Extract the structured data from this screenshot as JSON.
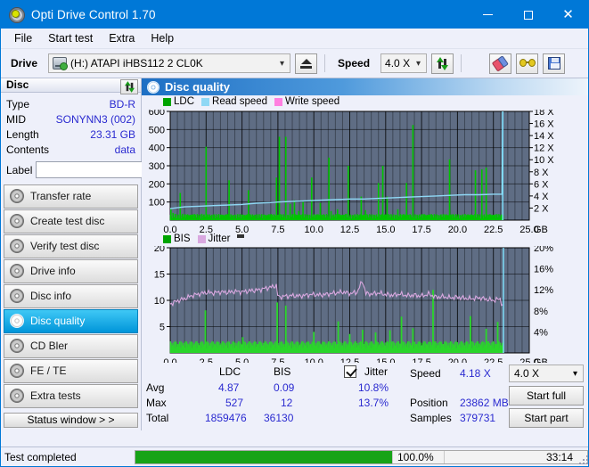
{
  "window": {
    "title": "Opti Drive Control 1.70",
    "icon": "disc-icon",
    "minimize": "–",
    "maximize": "□",
    "close": "✕"
  },
  "menu": {
    "items": [
      "File",
      "Start test",
      "Extra",
      "Help"
    ]
  },
  "toolbar": {
    "drive_label": "Drive",
    "drive_value": "(H:)  ATAPI iHBS112  2 CL0K",
    "drive_icon": "drive-icon",
    "eject_icon": "eject-icon",
    "speed_label": "Speed",
    "speed_value": "4.0 X",
    "refresh_icon": "refresh-icon",
    "eraser_icon": "eraser-icon",
    "glasses_icon": "glasses-icon",
    "save_icon": "save-icon",
    "chevron": "⌄"
  },
  "disc_panel": {
    "title": "Disc",
    "refresh_icon": "refresh-icon",
    "rows": [
      {
        "key": "Type",
        "value": "BD-R"
      },
      {
        "key": "MID",
        "value": "SONYNN3 (002)"
      },
      {
        "key": "Length",
        "value": "23.31 GB"
      },
      {
        "key": "Contents",
        "value": "data"
      }
    ],
    "label_key": "Label",
    "label_value": "",
    "label_placeholder": "",
    "disc_icon": "disc-icon"
  },
  "tests": {
    "items": [
      {
        "label": "Transfer rate",
        "active": false
      },
      {
        "label": "Create test disc",
        "active": false
      },
      {
        "label": "Verify test disc",
        "active": false
      },
      {
        "label": "Drive info",
        "active": false
      },
      {
        "label": "Disc info",
        "active": false
      },
      {
        "label": "Disc quality",
        "active": true
      },
      {
        "label": "CD Bler",
        "active": false
      },
      {
        "label": "FE / TE",
        "active": false
      },
      {
        "label": "Extra tests",
        "active": false
      }
    ],
    "status_window": "Status window > >"
  },
  "content": {
    "header_title": "Disc quality",
    "header_icon": "disc-quality-icon"
  },
  "chart_data": [
    {
      "type": "line",
      "name": "ldc-read-speed-chart",
      "title": "",
      "xlabel": "GB",
      "ylabel": "",
      "legend": [
        {
          "label": "LDC",
          "color": "#00a400"
        },
        {
          "label": "Read speed",
          "color": "#8fd8f5"
        },
        {
          "label": "Write speed",
          "color": "#ff7fe0"
        }
      ],
      "xlim": [
        0,
        25.0
      ],
      "xticks": [
        "0.0",
        "2.5",
        "5.0",
        "7.5",
        "10.0",
        "12.5",
        "15.0",
        "17.5",
        "20.0",
        "22.5",
        "25.0"
      ],
      "x_unit": "GB",
      "ylim": [
        0,
        600
      ],
      "yticks": [
        100,
        200,
        300,
        400,
        500,
        600
      ],
      "y2lim": [
        0,
        18
      ],
      "y2ticks": [
        "2 X",
        "4 X",
        "6 X",
        "8 X",
        "10 X",
        "12 X",
        "14 X",
        "16 X",
        "18 X"
      ],
      "grid": true,
      "series": [
        {
          "name": "LDC",
          "color": "#00c400",
          "type": "bar",
          "x": [
            0.05,
            0.2,
            0.35,
            0.55,
            0.7,
            0.85,
            1.0,
            1.15,
            1.3,
            1.45,
            1.6,
            1.75,
            1.9,
            2.05,
            2.2,
            2.35,
            2.5,
            2.6,
            2.75,
            2.9,
            3.05,
            3.2,
            3.35,
            3.5,
            3.65,
            3.8,
            3.95,
            4.1,
            4.25,
            4.4,
            4.55,
            4.7,
            4.85,
            5.0,
            5.15,
            5.3,
            5.45,
            5.6,
            5.75,
            5.9,
            6.05,
            6.2,
            6.35,
            6.5,
            6.65,
            6.8,
            6.95,
            7.1,
            7.25,
            7.4,
            7.5,
            7.6,
            7.75,
            7.9,
            8.05,
            8.2,
            8.35,
            8.5,
            8.65,
            8.8,
            8.95,
            9.1,
            9.25,
            9.4,
            9.55,
            9.7,
            9.85,
            10.0,
            10.15,
            10.3,
            10.45,
            10.6,
            10.75,
            10.9,
            11.05,
            11.2,
            11.35,
            11.5,
            11.65,
            11.8,
            11.95,
            12.1,
            12.25,
            12.4,
            12.55,
            12.7,
            12.85,
            13.0,
            13.15,
            13.3,
            13.45,
            13.6,
            13.75,
            13.9,
            14.05,
            14.2,
            14.35,
            14.5,
            14.65,
            14.8,
            14.95,
            15.1,
            15.25,
            15.4,
            15.55,
            15.7,
            15.85,
            16.0,
            16.15,
            16.3,
            16.45,
            16.6,
            16.75,
            16.9,
            17.05,
            17.2,
            17.35,
            17.5,
            17.65,
            17.8,
            17.95,
            18.1,
            18.25,
            18.4,
            18.55,
            18.7,
            18.85,
            19.0,
            19.15,
            19.3,
            19.45,
            19.6,
            19.75,
            19.9,
            20.05,
            20.2,
            20.35,
            20.5,
            20.65,
            20.8,
            20.95,
            21.1,
            21.25,
            21.4,
            21.55,
            21.7,
            21.85,
            22.0,
            22.15,
            22.3,
            22.45,
            22.6,
            22.75,
            22.9,
            23.05,
            23.2
          ],
          "values": [
            60,
            40,
            35,
            30,
            150,
            35,
            30,
            30,
            28,
            30,
            32,
            30,
            30,
            30,
            35,
            30,
            405,
            30,
            28,
            30,
            32,
            28,
            30,
            30,
            30,
            28,
            32,
            220,
            30,
            28,
            30,
            30,
            32,
            30,
            28,
            30,
            165,
            30,
            28,
            30,
            32,
            28,
            30,
            30,
            28,
            30,
            32,
            30,
            30,
            235,
            28,
            460,
            30,
            28,
            460,
            30,
            90,
            32,
            110,
            30,
            50,
            30,
            100,
            28,
            30,
            30,
            235,
            30,
            28,
            32,
            95,
            30,
            28,
            30,
            345,
            50,
            28,
            30,
            60,
            32,
            28,
            30,
            35,
            300,
            30,
            28,
            32,
            30,
            28,
            130,
            30,
            55,
            28,
            30,
            32,
            30,
            28,
            205,
            30,
            300,
            32,
            130,
            30,
            28,
            32,
            30,
            60,
            28,
            30,
            32,
            205,
            30,
            28,
            525,
            32,
            30,
            28,
            30,
            32,
            28,
            30,
            32,
            28,
            30,
            32,
            28,
            30,
            32,
            30,
            28,
            335,
            32,
            28,
            30,
            32,
            28,
            30,
            32,
            28,
            30,
            32,
            28,
            275,
            30,
            32,
            280,
            28,
            290,
            30,
            32,
            28,
            30,
            32,
            28,
            30
          ]
        },
        {
          "name": "Read speed",
          "color": "#8fd8f5",
          "type": "line",
          "x": [
            0.0,
            1.0,
            2.0,
            3.0,
            4.0,
            5.0,
            6.0,
            7.0,
            7.5,
            8.5,
            9.5,
            10.5,
            11.5,
            12.5,
            13.5,
            14.5,
            15.5,
            16.5,
            17.5,
            18.5,
            19.5,
            20.5,
            21.5,
            22.5,
            23.1,
            23.15
          ],
          "values": [
            1.9,
            2.2,
            2.3,
            2.4,
            2.5,
            2.6,
            2.8,
            2.9,
            3.0,
            3.1,
            3.2,
            3.3,
            3.4,
            3.5,
            3.5,
            3.6,
            3.7,
            3.8,
            3.9,
            4.0,
            4.1,
            4.2,
            4.2,
            4.3,
            4.3,
            18.0
          ]
        }
      ]
    },
    {
      "type": "line",
      "name": "bis-jitter-chart",
      "title": "",
      "xlabel": "GB",
      "legend": [
        {
          "label": "BIS",
          "color": "#00a400"
        },
        {
          "label": "Jitter",
          "color": "#d9a8e0"
        }
      ],
      "xlim": [
        0,
        25.0
      ],
      "xticks": [
        "0.0",
        "2.5",
        "5.0",
        "7.5",
        "10.0",
        "12.5",
        "15.0",
        "17.5",
        "20.0",
        "22.5",
        "25.0"
      ],
      "x_unit": "GB",
      "ylim": [
        0,
        20
      ],
      "yticks": [
        5,
        10,
        15,
        20
      ],
      "y2lim": [
        0,
        20
      ],
      "y2ticks": [
        "4%",
        "8%",
        "12%",
        "16%",
        "20%"
      ],
      "grid": true,
      "series": [
        {
          "name": "BIS",
          "color": "#2ad62a",
          "type": "bar",
          "baseline": 1.6,
          "spikes": [
            {
              "x": 2.45,
              "v": 8.1
            },
            {
              "x": 7.45,
              "v": 9.6
            },
            {
              "x": 8.05,
              "v": 9.0
            },
            {
              "x": 5.05,
              "v": 3.0
            },
            {
              "x": 10.0,
              "v": 4.0
            },
            {
              "x": 11.7,
              "v": 6.0
            },
            {
              "x": 12.5,
              "v": 3.6
            },
            {
              "x": 13.4,
              "v": 4.4
            },
            {
              "x": 14.3,
              "v": 3.9
            },
            {
              "x": 15.3,
              "v": 4.3
            },
            {
              "x": 16.1,
              "v": 6.9
            },
            {
              "x": 16.9,
              "v": 4.7
            },
            {
              "x": 18.3,
              "v": 12.0
            },
            {
              "x": 20.9,
              "v": 7.0
            },
            {
              "x": 22.0,
              "v": 4.6
            },
            {
              "x": 22.8,
              "v": 5.9
            }
          ]
        },
        {
          "name": "Jitter",
          "color": "#d9a8e0",
          "type": "line",
          "unit": "%",
          "x": [
            0.0,
            0.5,
            1.0,
            1.5,
            2.0,
            2.5,
            3.0,
            3.5,
            4.0,
            4.5,
            5.0,
            5.5,
            6.0,
            6.5,
            7.0,
            7.4,
            7.5,
            8.0,
            8.5,
            9.0,
            9.5,
            10.0,
            10.5,
            11.0,
            11.5,
            12.0,
            12.5,
            13.0,
            13.4,
            13.6,
            14.0,
            14.5,
            15.0,
            15.5,
            16.0,
            16.5,
            17.0,
            17.5,
            18.0,
            18.5,
            19.0,
            19.5,
            20.0,
            20.5,
            21.0,
            21.5,
            22.0,
            22.5,
            23.0,
            23.1
          ],
          "values": [
            9.3,
            9.9,
            10.3,
            10.9,
            11.2,
            11.5,
            11.4,
            11.6,
            11.5,
            11.7,
            11.6,
            11.8,
            11.9,
            12.2,
            12.5,
            12.8,
            10.6,
            10.8,
            10.9,
            10.8,
            11.0,
            11.1,
            11.0,
            11.2,
            11.4,
            11.6,
            11.3,
            11.5,
            13.8,
            11.3,
            11.2,
            11.4,
            11.1,
            11.0,
            11.2,
            10.9,
            11.0,
            10.8,
            11.2,
            10.6,
            10.7,
            10.5,
            10.6,
            10.4,
            10.3,
            10.5,
            10.2,
            10.0,
            10.3,
            9.0
          ]
        }
      ]
    }
  ],
  "stats": {
    "col_headers": {
      "ldc": "LDC",
      "bis": "BIS",
      "jitter": "Jitter"
    },
    "row_labels": {
      "avg": "Avg",
      "max": "Max",
      "total": "Total"
    },
    "ldc": {
      "avg": "4.87",
      "max": "527",
      "total": "1859476"
    },
    "bis": {
      "avg": "0.09",
      "max": "12",
      "total": "36130"
    },
    "jitter": {
      "checked": true,
      "avg": "10.8%",
      "max": "13.7%"
    },
    "speed_label": "Speed",
    "speed_value": "4.18 X",
    "position_label": "Position",
    "position_value": "23862 MB",
    "samples_label": "Samples",
    "samples_value": "379731",
    "speed_select": "4.0 X",
    "chevron": "⌄",
    "start_full": "Start full",
    "start_part": "Start part"
  },
  "statusbar": {
    "text": "Test completed",
    "progress_pct": "100.0%",
    "progress_value": 100,
    "time": "33:14"
  },
  "colors": {
    "accent": "#0078d7",
    "plot_bg": "#5f6d84",
    "ldc_green": "#00c400",
    "read_speed": "#8fd8f5",
    "write_speed": "#ff7fe0",
    "jitter": "#d9a8e0",
    "value_blue": "#2a2ad0",
    "progress_green": "#17a317"
  }
}
